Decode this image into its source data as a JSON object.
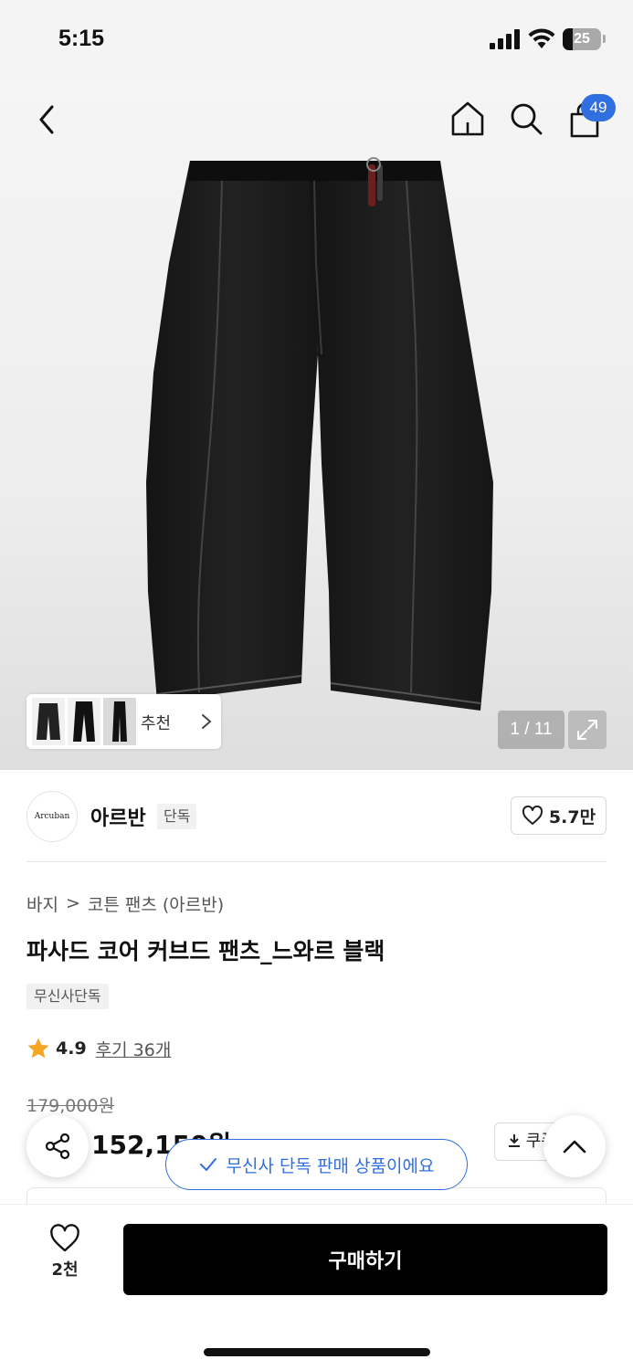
{
  "status_bar": {
    "time": "5:15",
    "battery": "25",
    "battery_level": 0.25
  },
  "nav": {
    "back_icon": "chevron-left-icon",
    "home_icon": "home-icon",
    "search_icon": "search-icon",
    "cart_icon": "shopping-bag-icon",
    "cart_count": "49"
  },
  "gallery": {
    "recommend_label": "추천",
    "counter": "1 / 11",
    "expand_icon": "expand-icon"
  },
  "brand": {
    "logo_text": "Arcuban",
    "name": "아르반",
    "badge": "단독",
    "like_count": "5.7만"
  },
  "breadcrumb": {
    "category": "바지",
    "separator": ">",
    "subcategory": "코튼 팬츠 (아르반)"
  },
  "product": {
    "title": "파사드 코어 커브드 팬츠_느와르 블랙",
    "tag": "무신사단독",
    "rating": "4.9",
    "reviews": "후기 36개",
    "original_price": "179,000원",
    "sale_price": "152,150원"
  },
  "actions": {
    "coupon_label": "쿠폰",
    "toast": "무신사 단독 판매 상품이에요",
    "wish_count": "2천",
    "buy_label": "구매하기"
  },
  "colors": {
    "accent_blue": "#2f6fe0",
    "star": "#f5a623",
    "buy_button": "#000000"
  }
}
